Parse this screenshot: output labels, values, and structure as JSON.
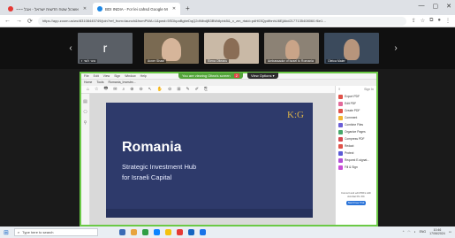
{
  "browser": {
    "tabs": [
      {
        "label": "~~~ אשכול שטח חדשות ישראל - אבל",
        "active": false,
        "color": "#e53935"
      },
      {
        "label": "BDI INDIA - Fo! lei cahsd Google M",
        "active": true,
        "color": "#1e88e5"
      }
    ],
    "newtab": "+",
    "url": "https://app.zoom.us/wc/83108445749/join?ref_from=launch&fromPWA=1&pwd=5SDkpaBgbeDqQ2dNlbdjB3BWdlpbk5&_x_zm_rtaid=pdH03QpdfbnhU6EjAkd2177135408060.f6e1…",
    "nav": {
      "back": "←",
      "forward": "→",
      "reload": "⟳"
    },
    "win_ctrls": [
      "—",
      "▢",
      "✕"
    ]
  },
  "meeting": {
    "participants": [
      {
        "name": "r",
        "label": "r  נוער לוסי",
        "bg": "#5a5f66"
      },
      {
        "name": "",
        "label": "Avner Shaw",
        "bg": "#7a6a52"
      },
      {
        "name": "",
        "label": "Elena Olteanu",
        "bg": "#c9b9a6"
      },
      {
        "name": "",
        "label": "Ambassador of Israel to Romania",
        "bg": "#8c8275"
      },
      {
        "name": "",
        "label": "Oleica Maier",
        "bg": "#3b4a5c"
      }
    ],
    "share_banner": "You are viewing  Oltea's screen",
    "share_banner_stop": "2",
    "view_options": "View Options ▾",
    "prev": "‹",
    "next": "›"
  },
  "acrobat": {
    "menu": [
      "File",
      "Edit",
      "View",
      "Sign",
      "Window",
      "Help"
    ],
    "tabs": [
      "Home",
      "Tools",
      "Romania_Investm..."
    ],
    "tool_icons": [
      "⌂",
      "☆",
      "🖶",
      "✉",
      "⌕",
      "⊕",
      "⊖",
      "↖",
      "✋",
      "⊝",
      "⊞",
      "✎",
      "✐",
      "⎘"
    ],
    "right_top": {
      "left": "⍰",
      "signin": "Sign In"
    },
    "right_tools": [
      {
        "label": "Export PDF",
        "color": "#e0534a"
      },
      {
        "label": "Edit PDF",
        "color": "#e26a9a"
      },
      {
        "label": "Create PDF",
        "color": "#e0534a"
      },
      {
        "label": "Comment",
        "color": "#f2b632"
      },
      {
        "label": "Combine Files",
        "color": "#6b5ed6"
      },
      {
        "label": "Organize Pages",
        "color": "#47a86b"
      },
      {
        "label": "Compress PDF",
        "color": "#d6474f"
      },
      {
        "label": "Redact",
        "color": "#e0534a"
      },
      {
        "label": "Protect",
        "color": "#5b5bd6"
      },
      {
        "label": "Request E-signat...",
        "color": "#b34fd6"
      },
      {
        "label": "Fill & Sign",
        "color": "#c94fd6"
      }
    ],
    "promo_text": "Convert and edit PDFs with Acrobat Pro DC",
    "promo_button": "Start Free Trial"
  },
  "slide": {
    "logo": "K:G",
    "title": "Romania",
    "subtitle_line1": "Strategic Investment Hub",
    "subtitle_line2": "for Israeli Capital"
  },
  "taskbar": {
    "search_placeholder": "Type here to search",
    "apps": [
      "#3b6bb5",
      "#e7a33e",
      "#2f9e44",
      "#0a84ff",
      "#f4c20d",
      "#e53935",
      "#1565c0",
      "#1a73e8"
    ],
    "time": "10:46",
    "date": "17/06/2024",
    "lang": "ENG"
  },
  "colors": {
    "share_border": "#6bc946",
    "slide_bg": "#2e3a6b",
    "logo_gold": "#d8b04a"
  }
}
